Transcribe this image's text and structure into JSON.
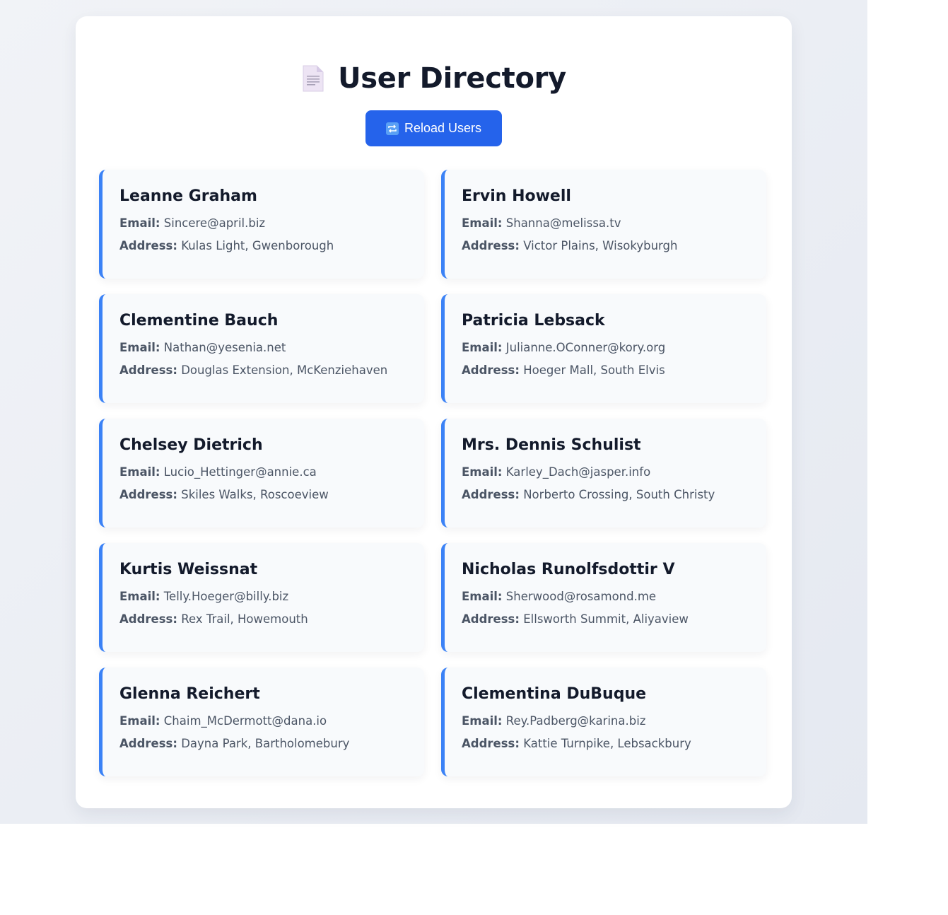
{
  "header": {
    "icon": "document-icon",
    "title": "User Directory"
  },
  "toolbar": {
    "reload_icon": "repeat-icon",
    "reload_label": "Reload Users"
  },
  "labels": {
    "email": "Email:",
    "address": "Address:"
  },
  "users": [
    {
      "name": "Leanne Graham",
      "email": "Sincere@april.biz",
      "address": "Kulas Light, Gwenborough"
    },
    {
      "name": "Ervin Howell",
      "email": "Shanna@melissa.tv",
      "address": "Victor Plains, Wisokyburgh"
    },
    {
      "name": "Clementine Bauch",
      "email": "Nathan@yesenia.net",
      "address": "Douglas Extension, McKenziehaven"
    },
    {
      "name": "Patricia Lebsack",
      "email": "Julianne.OConner@kory.org",
      "address": "Hoeger Mall, South Elvis"
    },
    {
      "name": "Chelsey Dietrich",
      "email": "Lucio_Hettinger@annie.ca",
      "address": "Skiles Walks, Roscoeview"
    },
    {
      "name": "Mrs. Dennis Schulist",
      "email": "Karley_Dach@jasper.info",
      "address": "Norberto Crossing, South Christy"
    },
    {
      "name": "Kurtis Weissnat",
      "email": "Telly.Hoeger@billy.biz",
      "address": "Rex Trail, Howemouth"
    },
    {
      "name": "Nicholas Runolfsdottir V",
      "email": "Sherwood@rosamond.me",
      "address": "Ellsworth Summit, Aliyaview"
    },
    {
      "name": "Glenna Reichert",
      "email": "Chaim_McDermott@dana.io",
      "address": "Dayna Park, Bartholomebury"
    },
    {
      "name": "Clementina DuBuque",
      "email": "Rey.Padberg@karina.biz",
      "address": "Kattie Turnpike, Lebsackbury"
    }
  ],
  "colors": {
    "accent": "#2563eb",
    "card_border": "#3b82f6",
    "title": "#131a2b",
    "text": "#4b5565"
  }
}
